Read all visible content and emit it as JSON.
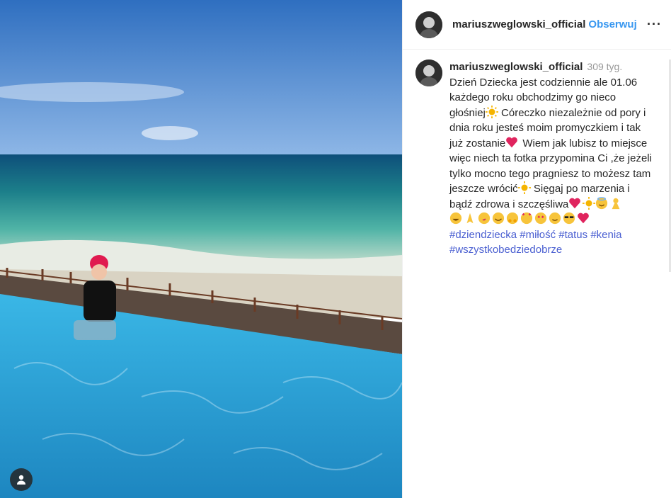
{
  "post": {
    "username": "mariuszweglowski_official",
    "follow_label": "Obserwuj",
    "more_label": "···"
  },
  "caption": {
    "username": "mariuszweglowski_official",
    "time": "309 tyg.",
    "line1": "Dzień Dziecka jest codziennie ale 01.06 każdego roku obchodzimy go nieco głośniej",
    "line2": "Córeczko niezależnie od pory i dnia roku jesteś moim promyczkiem i tak już zostanie",
    "line3": "Wiem jak lubisz to miejsce  więc niech ta fotka przypomina Ci ,że jeżeli tylko mocno tego pragniesz to możesz tam jeszcze wrócić",
    "line4": "Sięgaj po marzenia i bądź zdrowa i szczęśliwa",
    "hashtags": [
      "#dziendziecka",
      "#miłość",
      "#tatus",
      "#kenia",
      "#wszystkobedziedobrze"
    ]
  },
  "icons": {
    "user_tag": "person-icon",
    "sun": "sun-emoji",
    "heart": "heart-emoji"
  },
  "colors": {
    "follow": "#3897f0",
    "hashtag": "#4a5fd1",
    "muted": "#999999"
  }
}
